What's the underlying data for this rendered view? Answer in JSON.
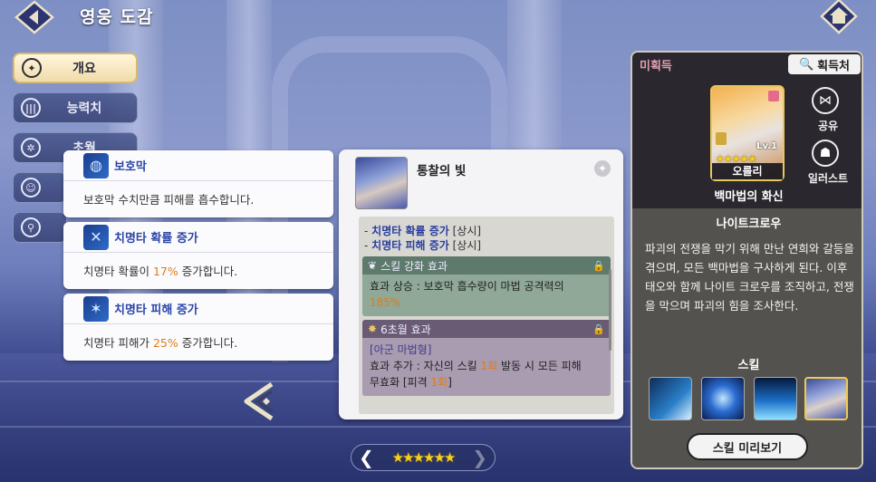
{
  "header": {
    "title": "영웅 도감"
  },
  "tabs": [
    {
      "label": "개요",
      "icon": "overview-icon"
    },
    {
      "label": "능력치",
      "icon": "stats-icon"
    },
    {
      "label": "초월",
      "icon": "transcend-icon"
    },
    {
      "label": "",
      "icon": "profile-icon"
    },
    {
      "label": "",
      "icon": "equipment-icon"
    }
  ],
  "passives": [
    {
      "name": "보호막",
      "desc": "보호막 수치만큼 피해를 흡수합니다."
    },
    {
      "name": "치명타 확률 증가",
      "desc_prefix": "치명타 확률이 ",
      "desc_value": "17%",
      "desc_suffix": " 증가합니다."
    },
    {
      "name": "치명타 피해 증가",
      "desc_prefix": "치명타 피해가 ",
      "desc_value": "25%",
      "desc_suffix": " 증가합니다."
    }
  ],
  "skill_detail": {
    "title": "통찰의 빛",
    "line1_prefix": "- ",
    "line1_blue": "치명타 확률 증가",
    "line1_suffix": " [상시]",
    "line2_prefix": "- ",
    "line2_blue": "치명타 피해 증가",
    "line2_suffix": " [상시]",
    "enhance_title": "스킬 강화 효과",
    "enhance_text": "효과 상승 : 보호막 흡수량이 마법 공격력의",
    "enhance_value": "185%",
    "transcend_title": "6초월 효과",
    "transcend_sub": "[아군 마법형]",
    "transcend_text1": "효과 추가 : 자신의 스킬 ",
    "transcend_hl1": "1회",
    "transcend_text2": " 발동 시 모든 피해",
    "transcend_text3": "무효화 [피격 ",
    "transcend_hl2": "1회",
    "transcend_text4": "]"
  },
  "pager": {
    "stars": "★★★★★★",
    "star_count": 6
  },
  "hero": {
    "status": "미획득",
    "acquire_label": "획득처",
    "level": "Lv.1",
    "stars": "★★★★★",
    "name": "오를리",
    "share_label": "공유",
    "illust_label": "일러스트",
    "subtitle": "백마법의 화신",
    "faction": "나이트크로우",
    "lore": "파괴의 전쟁을 막기 위해 만난 연희와 갈등을 겪으며, 모든 백마법을 구사하게 된다. 이후 태오와 함께 나이트 크로우를 조직하고, 전쟁을 막으며 파괴의 힘을 조사한다.",
    "skill_label": "스킬",
    "preview_label": "스킬 미리보기"
  },
  "colors": {
    "accent_orange": "#e07d18",
    "passive_blue": "#2b45a8"
  }
}
